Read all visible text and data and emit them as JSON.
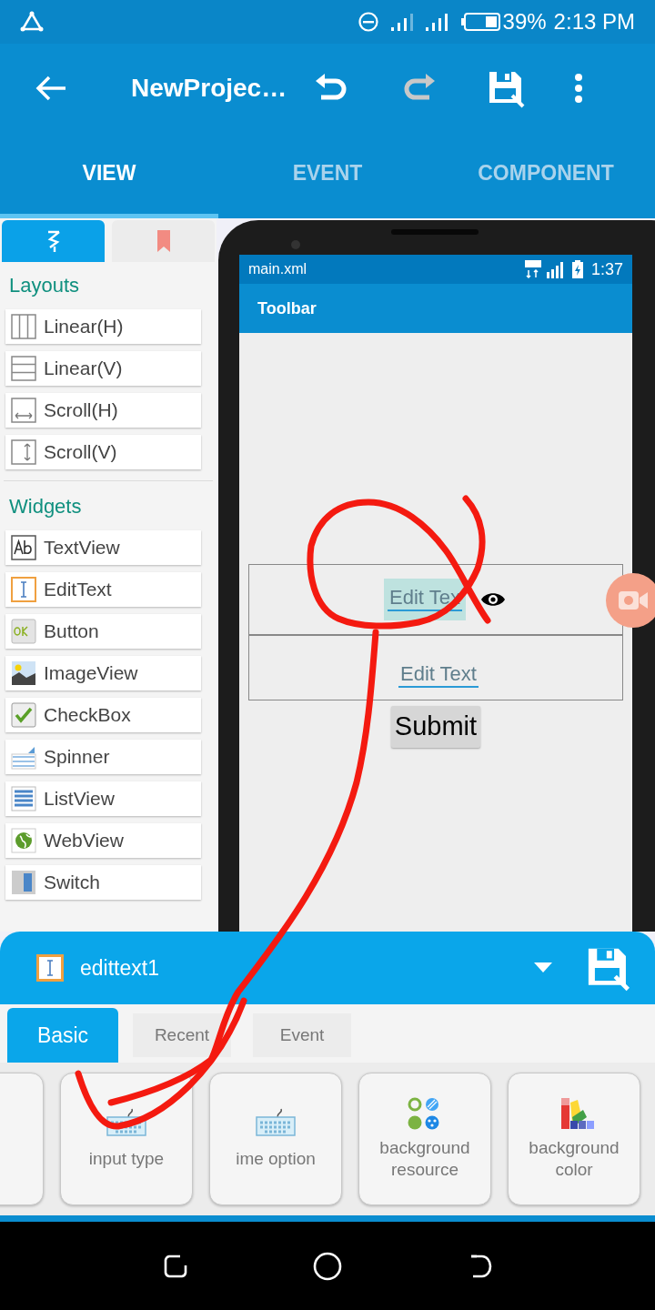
{
  "status_bar": {
    "battery": "39%",
    "time": "2:13 PM"
  },
  "toolbar": {
    "title": "NewProjec…"
  },
  "tabs": [
    {
      "label": "VIEW",
      "selected": true
    },
    {
      "label": "EVENT",
      "selected": false
    },
    {
      "label": "COMPONENT",
      "selected": false
    }
  ],
  "palette": {
    "tabs": [
      {
        "kind": "widgets",
        "selected": true
      },
      {
        "kind": "bookmark",
        "selected": false
      }
    ],
    "sections": [
      {
        "title": "Layouts",
        "items": [
          {
            "label": "Linear(H)",
            "kind": "linear_h"
          },
          {
            "label": "Linear(V)",
            "kind": "linear_v"
          },
          {
            "label": "Scroll(H)",
            "kind": "scroll_h"
          },
          {
            "label": "Scroll(V)",
            "kind": "scroll_v"
          }
        ]
      },
      {
        "title": "Widgets",
        "items": [
          {
            "label": "TextView",
            "kind": "textview"
          },
          {
            "label": "EditText",
            "kind": "edittext"
          },
          {
            "label": "Button",
            "kind": "button"
          },
          {
            "label": "ImageView",
            "kind": "imageview"
          },
          {
            "label": "CheckBox",
            "kind": "checkbox"
          },
          {
            "label": "Spinner",
            "kind": "spinner"
          },
          {
            "label": "ListView",
            "kind": "listview"
          },
          {
            "label": "WebView",
            "kind": "webview"
          },
          {
            "label": "Switch",
            "kind": "switch"
          }
        ]
      }
    ]
  },
  "preview": {
    "file": "main.xml",
    "time": "1:37",
    "toolbar_title": "Toolbar",
    "fields": [
      {
        "text": "Edit Tex",
        "selected": true
      },
      {
        "text": "Edit Text",
        "selected": false
      }
    ],
    "button": "Submit"
  },
  "properties": {
    "widget": "edittext1",
    "tabs": [
      {
        "label": "Basic",
        "selected": true
      },
      {
        "label": "Recent",
        "selected": false
      },
      {
        "label": "Event",
        "selected": false
      }
    ],
    "items": [
      {
        "kind": "blank"
      },
      {
        "label": "input type",
        "kind": "keyboard"
      },
      {
        "label": "ime option",
        "kind": "keyboard"
      },
      {
        "label": "background resource",
        "kind": "dots"
      },
      {
        "label": "background color",
        "kind": "swatches"
      }
    ]
  }
}
